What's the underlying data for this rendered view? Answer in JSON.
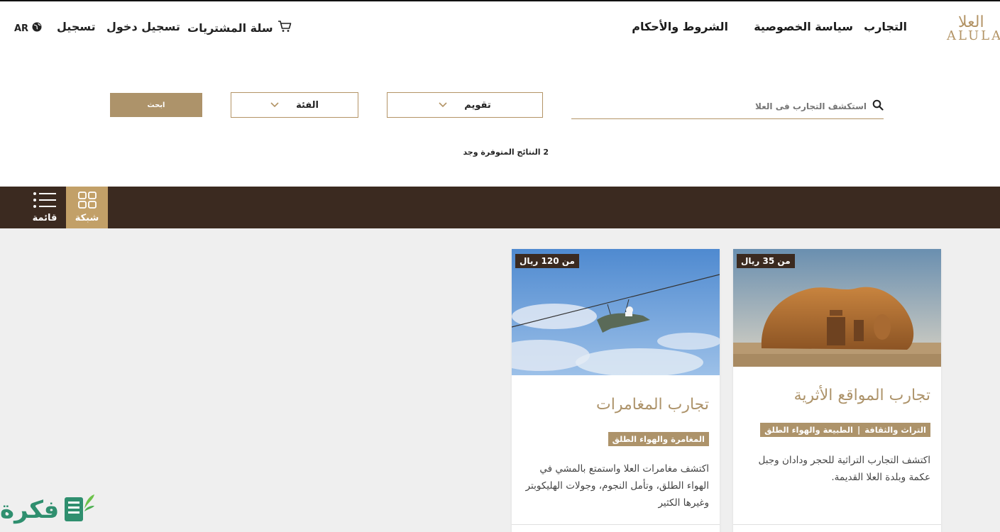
{
  "header": {
    "logo_arabic": "العلا",
    "logo_latin": "ALULA",
    "nav": {
      "experiences": "التجارب",
      "privacy": "سياسة الخصوصية",
      "terms": "الشروط والأحكام"
    },
    "cart_label": "سلة المشتريات",
    "login_label": "تسجيل دخول",
    "signup_label": "تسجيل",
    "lang_label": "AR"
  },
  "search": {
    "placeholder": "استكشف التجارب فى العلا",
    "calendar_label": "تقويم",
    "category_label": "الفئة",
    "button_label": "ابحث",
    "results_text": "2 النتائج المتوفرة وجد"
  },
  "view_toggle": {
    "grid_label": "شبكة",
    "list_label": "قائمة"
  },
  "cards": [
    {
      "price": "من 35 ريال",
      "title": "تجارب المواقع الأثرية",
      "tags": [
        "التراث والثقافة",
        "الطبيعة والهواء الطلق"
      ],
      "description": "اكتشف التجارب التراثية للحجر ودادان وجبل عكمة وبلدة العلا القديمة."
    },
    {
      "price": "من 120 ريال",
      "title": "تجارب المغامرات",
      "tags": [
        "المغامرة والهواء الطلق"
      ],
      "description": "اكتشف مغامرات العلا واستمتع بالمشي في الهواء الطلق، وتأمل النجوم، وجولات الهليكوبتر وغيرها الكثير"
    }
  ],
  "watermark": "فكرة",
  "colors": {
    "accent": "#ad936a",
    "dark_bar": "#3b2a20",
    "grid_active": "#c2a068",
    "content_bg": "#efefef"
  }
}
